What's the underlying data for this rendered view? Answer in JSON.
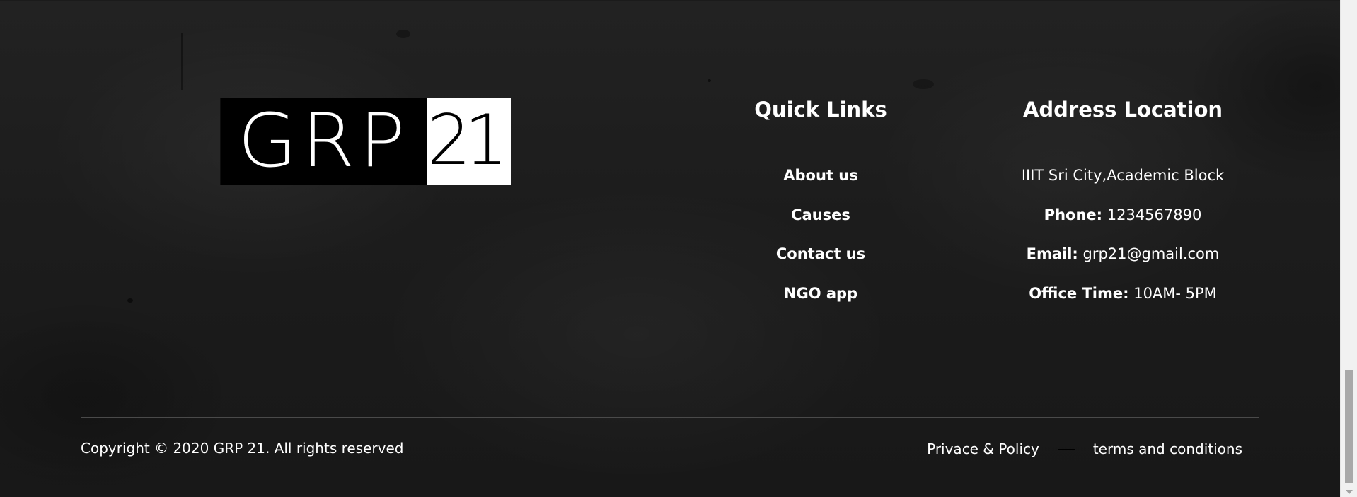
{
  "logo": {
    "left_text": "GRP",
    "right_text": "21"
  },
  "quick_links": {
    "title": "Quick Links",
    "items": [
      {
        "label": "About us"
      },
      {
        "label": "Causes"
      },
      {
        "label": "Contact us"
      },
      {
        "label": "NGO app"
      }
    ]
  },
  "address": {
    "title": "Address Location",
    "line1": "IIIT Sri City,Academic Block",
    "phone_label": "Phone:",
    "phone_value": "1234567890",
    "email_label": "Email:",
    "email_value": "grp21@gmail.com",
    "office_label": "Office Time:",
    "office_value": "10AM- 5PM"
  },
  "bottom": {
    "copyright": "Copyright © 2020 GRP 21. All rights reserved",
    "privacy": "Privace & Policy",
    "terms": "terms and conditions"
  },
  "colors": {
    "background": "#1b1b1b",
    "text": "#ffffff",
    "divider": "#4a4a4a"
  }
}
